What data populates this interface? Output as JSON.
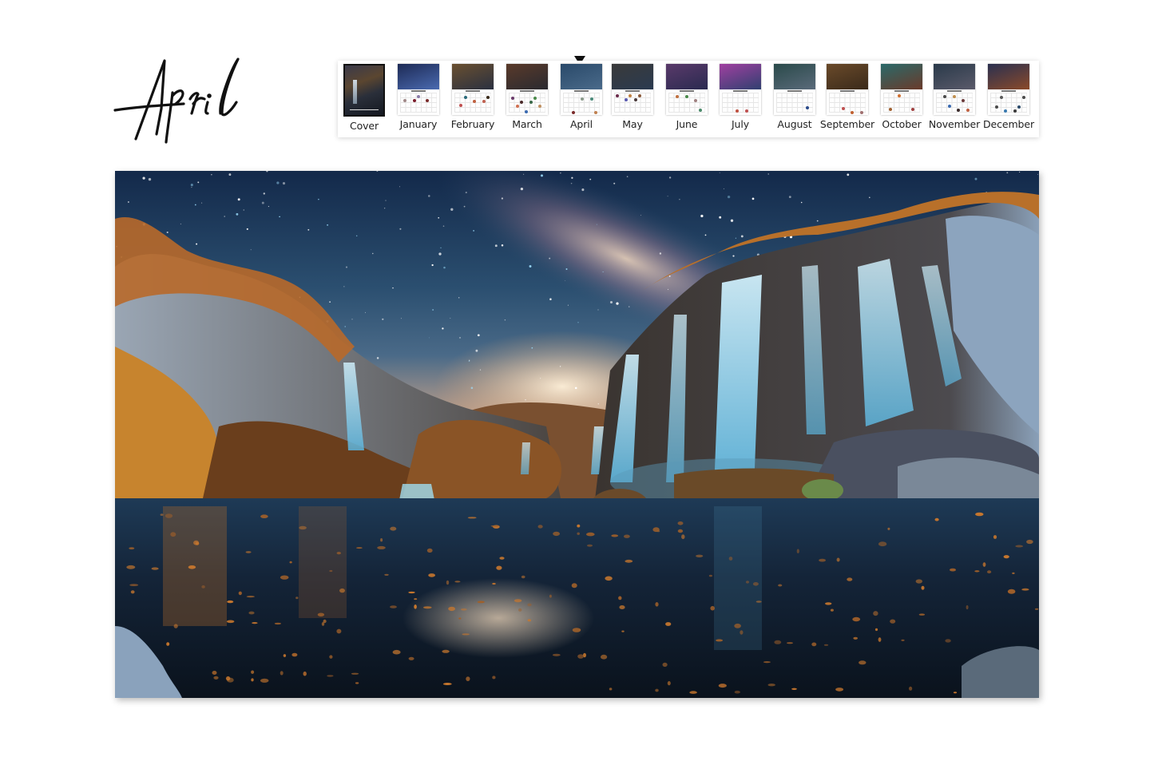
{
  "page": {
    "current_month": "April",
    "title_script": "April"
  },
  "thumbnails": {
    "selected_index": 4,
    "items": [
      {
        "label": "Cover",
        "type": "cover",
        "photo_colors": [
          "#3a3a4a",
          "#141820"
        ],
        "dots": []
      },
      {
        "label": "January",
        "type": "month",
        "photo_colors": [
          "#1d2a55",
          "#4a6ab0"
        ],
        "dots": [
          "#8a7aa8",
          "#7a2a2a",
          "#a08888",
          "#7a1a2a"
        ]
      },
      {
        "label": "February",
        "type": "month",
        "photo_colors": [
          "#6a5030",
          "#2a3040"
        ],
        "dots": [
          "#3a2a1a",
          "#2a6a7a",
          "#c06040",
          "#c06050",
          "#c05050"
        ]
      },
      {
        "label": "March",
        "type": "month",
        "photo_colors": [
          "#5a3a2a",
          "#2a2a30"
        ],
        "dots": [
          "#3a6ab0",
          "#4a8a4a",
          "#6a3a6a",
          "#4a2a2a",
          "#3a6a4a",
          "#c09060",
          "#d07050"
        ]
      },
      {
        "label": "April",
        "type": "month",
        "photo_colors": [
          "#2a4a6a",
          "#4a6a8a"
        ],
        "dots": [
          "#c08050",
          "#7a2a2a",
          "#8a9a8a",
          "#4a8a7a"
        ]
      },
      {
        "label": "May",
        "type": "month",
        "photo_colors": [
          "#3a3a3a",
          "#2a3a50"
        ],
        "dots": [
          "#c08040",
          "#8a5a3a",
          "#6a2a4a",
          "#5a5ab0",
          "#4a3a3a"
        ]
      },
      {
        "label": "June",
        "type": "month",
        "photo_colors": [
          "#5a3a6a",
          "#2a2a50"
        ],
        "dots": [
          "#4a8a6a",
          "#c07040",
          "#4a8a4a",
          "#a08080"
        ]
      },
      {
        "label": "July",
        "type": "month",
        "photo_colors": [
          "#a040a0",
          "#304070"
        ],
        "dots": [
          "#c05040",
          "#c05050"
        ]
      },
      {
        "label": "August",
        "type": "month",
        "photo_colors": [
          "#2a4a4a",
          "#5a6a7a"
        ],
        "dots": [
          "#2a4a8a"
        ]
      },
      {
        "label": "September",
        "type": "month",
        "photo_colors": [
          "#6a4a2a",
          "#3a2a1a"
        ],
        "dots": [
          "#c05050",
          "#c06030",
          "#a07070"
        ]
      },
      {
        "label": "October",
        "type": "month",
        "photo_colors": [
          "#2a6a6a",
          "#6a3a2a"
        ],
        "dots": [
          "#a04040",
          "#a06030",
          "#d07030"
        ]
      },
      {
        "label": "November",
        "type": "month",
        "photo_colors": [
          "#2a3a4a",
          "#5a5a6a"
        ],
        "dots": [
          "#3a6ab0",
          "#3a2a2a",
          "#c06040",
          "#4a4a4a",
          "#c09050",
          "#6a3a3a"
        ]
      },
      {
        "label": "December",
        "type": "month",
        "photo_colors": [
          "#2a3050",
          "#8a4a2a"
        ],
        "dots": [
          "#2a4a6a",
          "#4a4a4a",
          "#3a7ab0",
          "#3a3a3a",
          "#4a4a4a",
          "#5a5a5a"
        ]
      }
    ]
  },
  "hero_image": {
    "description": "Starry night sky with Milky Way over autumn cliffs and blue waterfalls reflecting in a lake with floating leaves",
    "colors": {
      "sky_top": "#13294a",
      "sky_mid": "#2f5676",
      "glow": "#e8b890",
      "foliage": "#c7772e",
      "rock": "#5a5450",
      "waterfall": "#8fd0ea",
      "lake": "#101c2c"
    }
  }
}
